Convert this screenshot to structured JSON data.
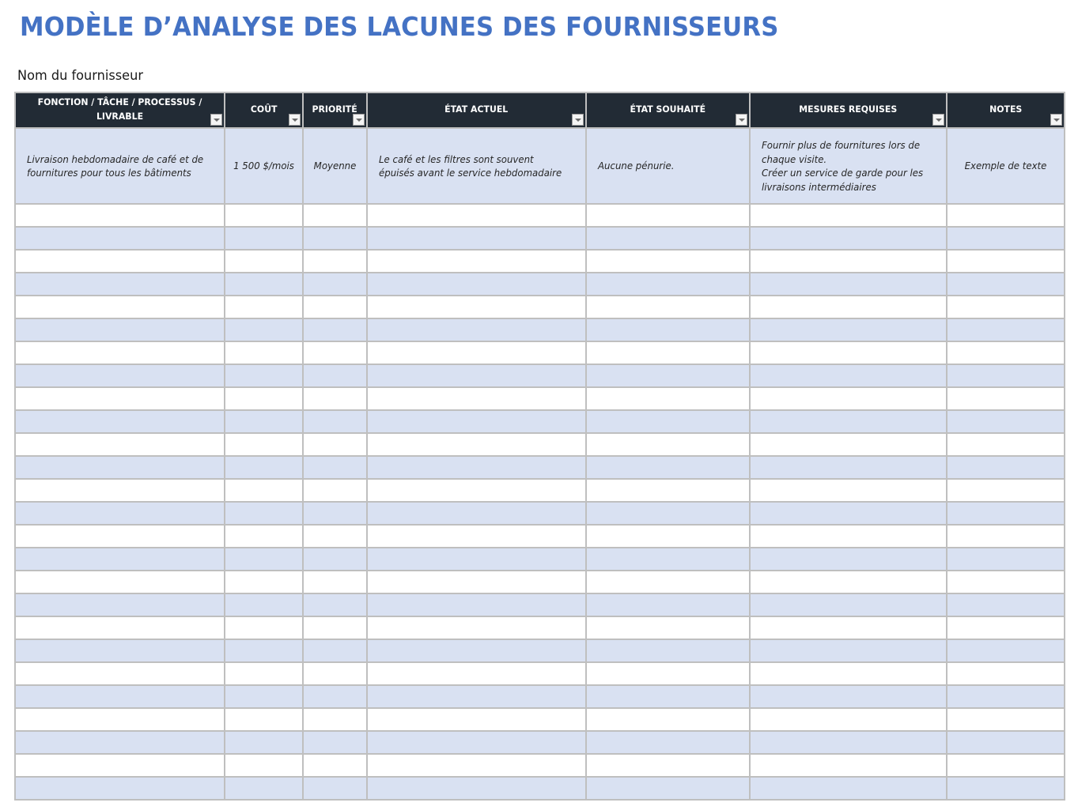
{
  "document": {
    "title": "MODÈLE D’ANALYSE DES LACUNES DES FOURNISSEURS",
    "supplier_label": "Nom du fournisseur"
  },
  "table": {
    "columns": [
      {
        "key": "function",
        "label": "FONCTION / TÂCHE / PROCESSUS / LIVRABLE",
        "filter_icon": "dropdown-filter-icon"
      },
      {
        "key": "cost",
        "label": "COÛT",
        "filter_icon": "dropdown-filter-icon"
      },
      {
        "key": "priority",
        "label": "PRIORITÉ",
        "filter_icon": "dropdown-filter-icon"
      },
      {
        "key": "current_state",
        "label": "ÉTAT ACTUEL",
        "filter_icon": "dropdown-filter-icon"
      },
      {
        "key": "desired_state",
        "label": "ÉTAT SOUHAITÉ",
        "filter_icon": "dropdown-filter-icon"
      },
      {
        "key": "actions_required",
        "label": "MESURES REQUISES",
        "filter_icon": "dropdown-filter-icon"
      },
      {
        "key": "notes",
        "label": "NOTES",
        "filter_icon": "dropdown-filter-icon"
      }
    ],
    "rows": [
      {
        "function": "Livraison hebdomadaire de café et de fournitures pour tous les bâtiments",
        "cost": "1 500 $/mois",
        "priority": "Moyenne",
        "current_state": "Le café et les filtres sont souvent épuisés avant le service hebdomadaire",
        "desired_state": "Aucune pénurie.",
        "actions_required": "Fournir plus de fournitures lors de chaque visite.\nCréer un service de garde pour les livraisons intermédiaires",
        "notes": "Exemple de texte"
      }
    ],
    "empty_row_count": 26
  },
  "colors": {
    "title": "#4472C4",
    "header_bg": "#222B35",
    "header_text": "#FFFFFF",
    "band_blue": "#D9E1F2",
    "band_white": "#FFFFFF",
    "grid_line": "#BFBFBF"
  }
}
